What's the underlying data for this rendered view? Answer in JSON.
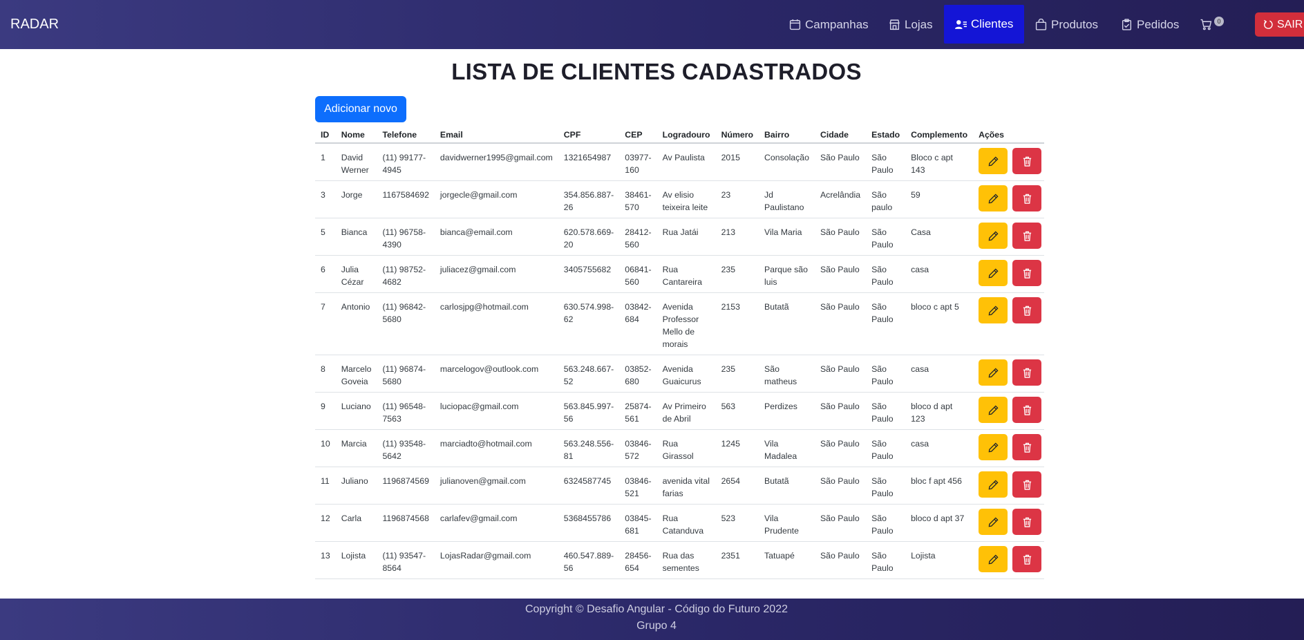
{
  "navbar": {
    "brand": "RADAR",
    "items": [
      {
        "label": "Campanhas",
        "icon": "calendar-icon"
      },
      {
        "label": "Lojas",
        "icon": "shop-icon"
      },
      {
        "label": "Clientes",
        "icon": "person-lines-icon",
        "active": true
      },
      {
        "label": "Produtos",
        "icon": "bag-icon"
      },
      {
        "label": "Pedidos",
        "icon": "clipboard-check-icon"
      }
    ],
    "cart_count": "0",
    "logout_label": "SAIR"
  },
  "page": {
    "title": "LISTA DE CLIENTES CADASTRADOS",
    "add_button": "Adicionar novo"
  },
  "table": {
    "headers": [
      "ID",
      "Nome",
      "Telefone",
      "Email",
      "CPF",
      "CEP",
      "Logradouro",
      "Número",
      "Bairro",
      "Cidade",
      "Estado",
      "Complemento",
      "Ações"
    ],
    "rows": [
      [
        "1",
        "David Werner",
        "(11) 99177-4945",
        "davidwerner1995@gmail.com",
        "1321654987",
        "03977-160",
        "Av Paulista",
        "2015",
        "Consolação",
        "São Paulo",
        "São Paulo",
        "Bloco c apt 143"
      ],
      [
        "3",
        "Jorge",
        "1167584692",
        "jorgecle@gmail.com",
        "354.856.887-26",
        "38461-570",
        "Av elisio teixeira leite",
        "23",
        "Jd Paulistano",
        "Acrelândia",
        "São paulo",
        "59"
      ],
      [
        "5",
        "Bianca",
        "(11) 96758-4390",
        "bianca@email.com",
        "620.578.669-20",
        "28412-560",
        "Rua Jatái",
        "213",
        "Vila Maria",
        "São Paulo",
        "São Paulo",
        "Casa"
      ],
      [
        "6",
        "Julia Cézar",
        "(11) 98752-4682",
        "juliacez@gmail.com",
        "3405755682",
        "06841-560",
        "Rua Cantareira",
        "235",
        "Parque são luis",
        "São Paulo",
        "São Paulo",
        "casa"
      ],
      [
        "7",
        "Antonio",
        "(11) 96842-5680",
        "carlosjpg@hotmail.com",
        "630.574.998-62",
        "03842-684",
        "Avenida Professor Mello de morais",
        "2153",
        "Butatã",
        "São Paulo",
        "São Paulo",
        "bloco c apt 5"
      ],
      [
        "8",
        "Marcelo Goveia",
        "(11) 96874-5680",
        "marcelogov@outlook.com",
        "563.248.667-52",
        "03852-680",
        "Avenida Guaicurus",
        "235",
        "São matheus",
        "São Paulo",
        "São Paulo",
        "casa"
      ],
      [
        "9",
        "Luciano",
        "(11) 96548-7563",
        "luciopac@gmail.com",
        "563.845.997-56",
        "25874-561",
        "Av Primeiro de Abril",
        "563",
        "Perdizes",
        "São Paulo",
        "São Paulo",
        "bloco d apt 123"
      ],
      [
        "10",
        "Marcia",
        "(11) 93548-5642",
        "marciadto@hotmail.com",
        "563.248.556-81",
        "03846-572",
        "Rua Girassol",
        "1245",
        "Vila Madalea",
        "São Paulo",
        "São Paulo",
        "casa"
      ],
      [
        "11",
        "Juliano",
        "1196874569",
        "julianoven@gmail.com",
        "6324587745",
        "03846-521",
        "avenida vital farias",
        "2654",
        "Butatã",
        "São Paulo",
        "São Paulo",
        "bloc f apt 456"
      ],
      [
        "12",
        "Carla",
        "1196874568",
        "carlafev@gmail.com",
        "5368455786",
        "03845-681",
        "Rua Catanduva",
        "523",
        "Vila Prudente",
        "São Paulo",
        "São Paulo",
        "bloco d apt 37"
      ],
      [
        "13",
        "Lojista",
        "(11) 93547-8564",
        "LojasRadar@gmail.com",
        "460.547.889-56",
        "28456-654",
        "Rua das sementes",
        "2351",
        "Tatuapé",
        "São Paulo",
        "São Paulo",
        "Lojista"
      ]
    ]
  },
  "footer": {
    "copyright": "Copyright © Desafio Angular - Código do Futuro 2022",
    "group": "Grupo 4"
  },
  "colors": {
    "navbar_gradient_start": "#3b3a80",
    "navbar_gradient_end": "#241e55",
    "active_nav": "#1415d6",
    "primary": "#0d6efd",
    "edit": "#ffc107",
    "delete": "#dc3545"
  }
}
